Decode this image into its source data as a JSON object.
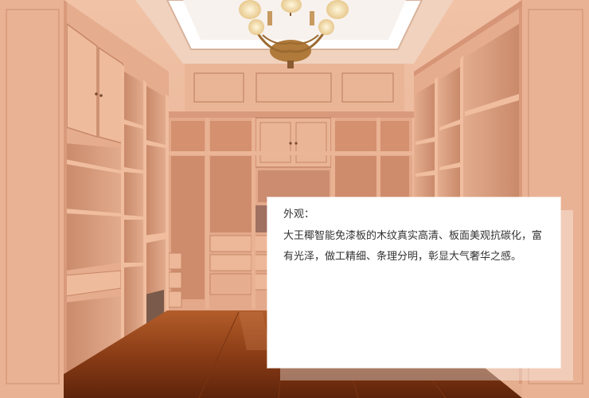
{
  "caption": {
    "heading": "外观：",
    "body": "大王椰智能免漆板的木纹真实高清、板面美观抗碳化，富有光泽，做工精细、条理分明，彰显大气奢华之感。"
  }
}
